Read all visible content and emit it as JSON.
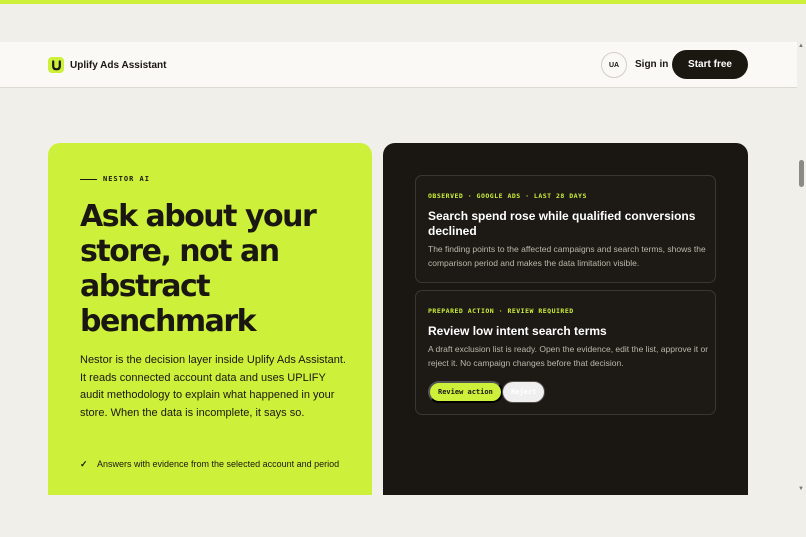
{
  "colors": {
    "accent": "#cdf03a",
    "dark": "#1a1712",
    "page_bg": "#f1efe9"
  },
  "header": {
    "brand": "Uplify Ads Assistant",
    "logo_icon": "u-logo-icon",
    "lang": "UA",
    "signin": "Sign in",
    "cta": "Start free"
  },
  "hero": {
    "eyebrow": "NESTOR AI",
    "headline": "Ask about your store, not an abstract benchmark",
    "intro": "Nestor is the decision layer inside Uplify Ads Assistant. It reads connected account data and uses UPLIFY audit methodology to explain what happened in your store. When the data is incomplete, it says so.",
    "checks": [
      {
        "icon": "check-icon",
        "mark": "✓",
        "text": "Answers with evidence from the selected account and period"
      }
    ]
  },
  "cards": {
    "finding": {
      "meta": "OBSERVED · GOOGLE ADS · LAST 28 DAYS",
      "title": "Search spend rose while qualified conversions declined",
      "body": "The finding points to the affected campaigns and search terms, shows the comparison period and makes the data limitation visible."
    },
    "action": {
      "meta": "PREPARED ACTION · REVIEW REQUIRED",
      "title": "Review low intent search terms",
      "body": "A draft exclusion list is ready. Open the evidence, edit the list, approve it or reject it. No campaign changes before that decision.",
      "review_label": "Review action",
      "reject_label": "Reject"
    }
  },
  "scrollbar": {
    "up_icon": "▲",
    "down_icon": "▼"
  }
}
